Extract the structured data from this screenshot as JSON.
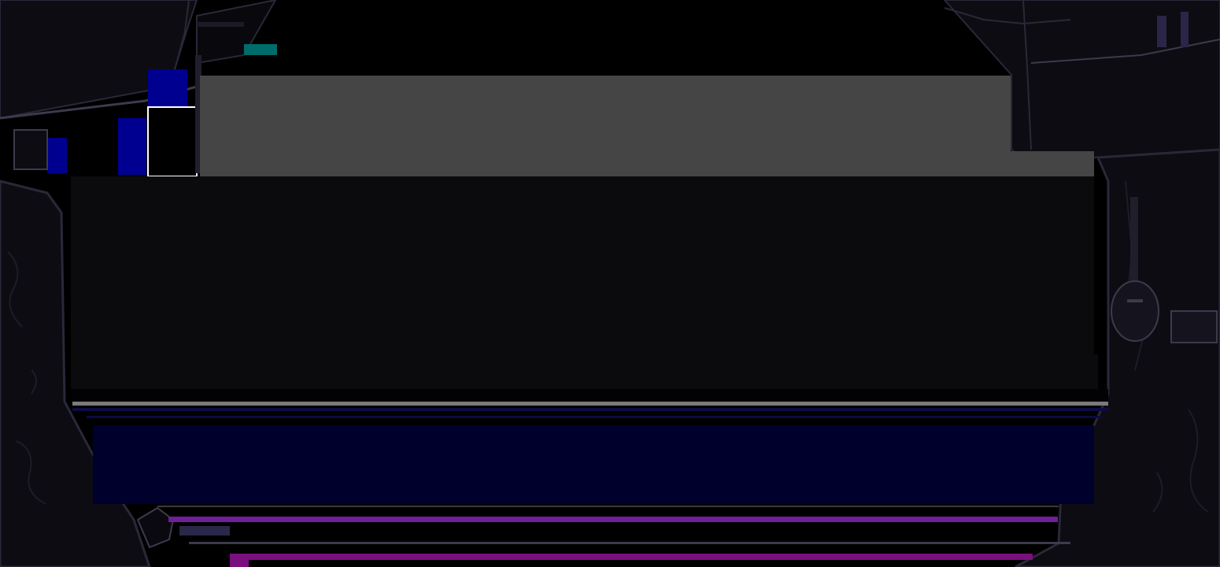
{
  "scene": {
    "description_visible_text": [],
    "colors": {
      "background": "#000000",
      "frame_dark": "#0d0c12",
      "frame_line": "#2a2838",
      "frame_line_light": "#3c3a4c",
      "panel_gray": "#454545",
      "panel_dark": "#0b0a0d",
      "separator_gray": "#7b7b7b",
      "band_navy": "#00002c",
      "band_navy_edge": "#0c0b44",
      "strip_purple": "#6f1f9a",
      "strip_magenta": "#7a0f7e",
      "accent_blue": "#000090",
      "accent_teal": "#006b6b",
      "accent_white": "#ffffff"
    },
    "icons": [
      "left-pillar-decoration-icon",
      "right-pillar-decoration-icon",
      "top-left-bracket-icon",
      "top-right-bracket-icon",
      "guitar-silhouette-icon",
      "bottom-left-hand-icon"
    ]
  }
}
